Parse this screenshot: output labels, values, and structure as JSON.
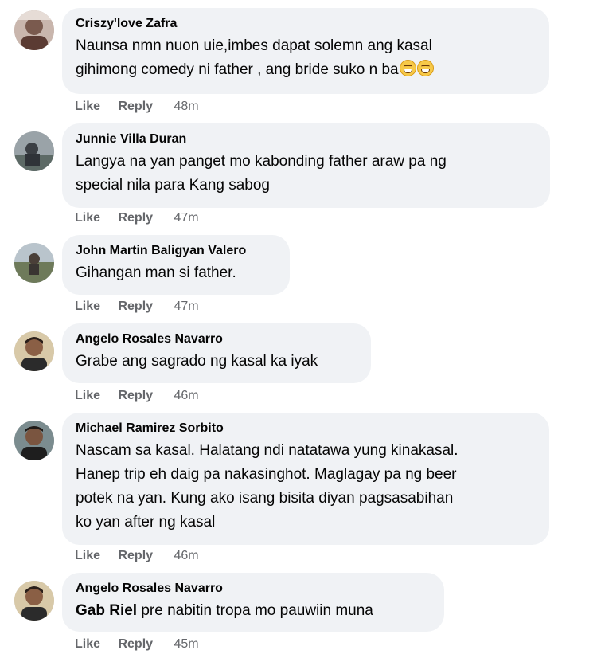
{
  "actions": {
    "like_label": "Like",
    "reply_label": "Reply"
  },
  "comments": [
    {
      "author": "Criszy'love Zafra",
      "lines": [
        "Naunsa nmn nuon uie,imbes dapat solemn ang kasal",
        "gihimong comedy ni father , ang bride suko n ba"
      ],
      "emojis": [
        "grinning-squinting-face-icon",
        "grinning-squinting-face-icon"
      ],
      "time": "48m"
    },
    {
      "author": "Junnie Villa Duran",
      "lines": [
        "Langya na yan panget mo kabonding father araw pa ng",
        "special nila para Kang sabog"
      ],
      "time": "47m"
    },
    {
      "author": "John Martin Baligyan Valero",
      "lines": [
        "Gihangan man si father."
      ],
      "time": "47m"
    },
    {
      "author": "Angelo Rosales Navarro",
      "lines": [
        "Grabe ang sagrado ng kasal ka iyak"
      ],
      "time": "46m"
    },
    {
      "author": "Michael Ramirez Sorbito",
      "lines": [
        "Nascam sa kasal. Halatang ndi natatawa yung kinakasal.",
        "Hanep trip eh daig pa nakasinghot. Maglagay pa ng beer",
        "potek na yan. Kung ako isang bisita diyan pagsasabihan",
        "ko yan after ng kasal"
      ],
      "time": "46m"
    },
    {
      "author": "Angelo Rosales Navarro",
      "mention": "Gab Riel",
      "lines": [
        " pre nabitin tropa mo pauwiin muna"
      ],
      "time": "45m"
    }
  ]
}
